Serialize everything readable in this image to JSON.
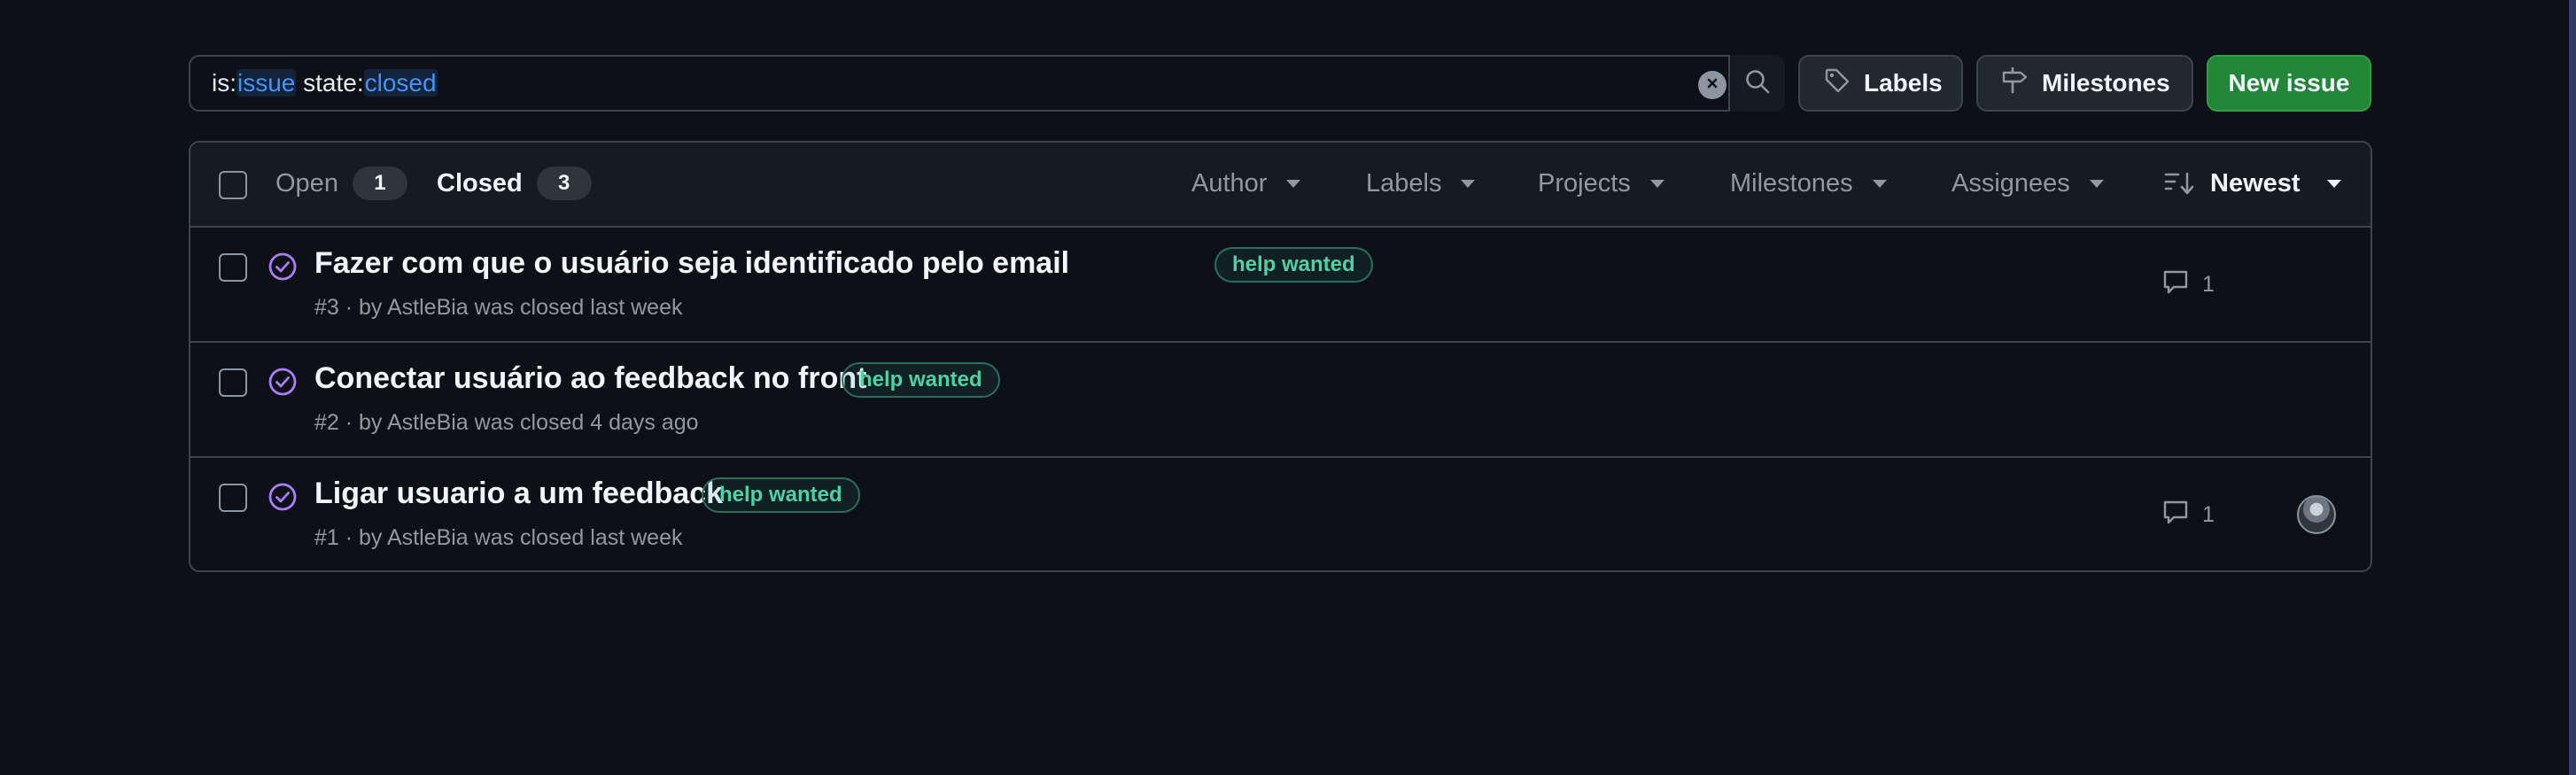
{
  "search": {
    "tokens": [
      {
        "key": "is:",
        "value": "issue"
      },
      {
        "key": " state:",
        "value": "closed"
      }
    ],
    "icons": {
      "clear": "clear-x-icon",
      "search": "search-icon"
    }
  },
  "buttons": {
    "labels": "Labels",
    "milestones": "Milestones",
    "new_issue": "New issue"
  },
  "state_tabs": {
    "open_label": "Open",
    "open_count": "1",
    "closed_label": "Closed",
    "closed_count": "3"
  },
  "filters": {
    "author": "Author",
    "labels": "Labels",
    "projects": "Projects",
    "milestones": "Milestones",
    "assignees": "Assignees",
    "sort": "Newest"
  },
  "issues": [
    {
      "title": "Fazer com que o usuário seja identificado pelo email",
      "label": "help wanted",
      "meta": "#3 · by AstleBia was closed last week",
      "comments": "1",
      "has_avatar": false
    },
    {
      "title": "Conectar usuário ao feedback no front",
      "label": "help wanted",
      "meta": "#2 · by AstleBia was closed 4 days ago",
      "comments": "",
      "has_avatar": false
    },
    {
      "title": "Ligar usuario a um feedback",
      "label": "help wanted",
      "meta": "#1 · by AstleBia was closed last week",
      "comments": "1",
      "has_avatar": true
    }
  ],
  "colors": {
    "background": "#0d1117",
    "border": "#3d444d",
    "accent_blue": "#4493f8",
    "closed_purple": "#ab7df8",
    "label_green": "#4fd1a5",
    "new_issue_green": "#238636"
  }
}
